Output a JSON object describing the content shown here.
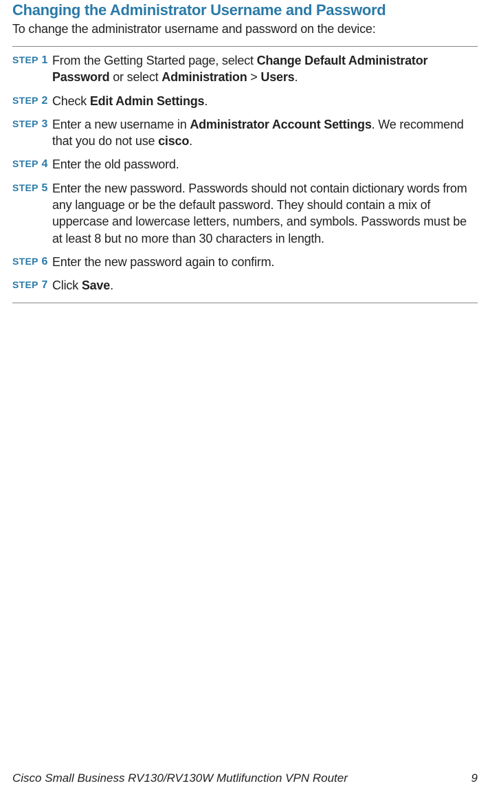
{
  "heading": "Changing the Administrator Username and Password",
  "intro": "To change the administrator username and password on the device:",
  "steps": [
    {
      "label": "STEP 1",
      "parts": [
        {
          "text": "From the Getting Started page, select ",
          "bold": false
        },
        {
          "text": "Change Default Administrator Password",
          "bold": true
        },
        {
          "text": " or select ",
          "bold": false
        },
        {
          "text": "Administration",
          "bold": true
        },
        {
          "text": " > ",
          "bold": false
        },
        {
          "text": "Users",
          "bold": true
        },
        {
          "text": ".",
          "bold": false
        }
      ]
    },
    {
      "label": "STEP 2",
      "parts": [
        {
          "text": "Check ",
          "bold": false
        },
        {
          "text": "Edit Admin Settings",
          "bold": true
        },
        {
          "text": ".",
          "bold": false
        }
      ]
    },
    {
      "label": "STEP 3",
      "parts": [
        {
          "text": "Enter a new username in ",
          "bold": false
        },
        {
          "text": "Administrator Account Settings",
          "bold": true
        },
        {
          "text": ". We recommend that you do not use ",
          "bold": false
        },
        {
          "text": "cisco",
          "bold": true
        },
        {
          "text": ".",
          "bold": false
        }
      ]
    },
    {
      "label": "STEP 4",
      "parts": [
        {
          "text": "Enter the old password.",
          "bold": false
        }
      ]
    },
    {
      "label": "STEP 5",
      "parts": [
        {
          "text": "Enter the new password. Passwords should not contain dictionary words from any language or be the default password. They should contain a mix of uppercase and lowercase letters, numbers, and symbols. Passwords must be at least 8 but no more than 30 characters in length.",
          "bold": false
        }
      ]
    },
    {
      "label": "STEP 6",
      "parts": [
        {
          "text": "Enter the new password again to confirm.",
          "bold": false
        }
      ]
    },
    {
      "label": "STEP 7",
      "parts": [
        {
          "text": "Click ",
          "bold": false
        },
        {
          "text": "Save",
          "bold": true
        },
        {
          "text": ".",
          "bold": false
        }
      ]
    }
  ],
  "footer": {
    "title": "Cisco Small Business RV130/RV130W Mutlifunction VPN Router",
    "page": "9"
  }
}
